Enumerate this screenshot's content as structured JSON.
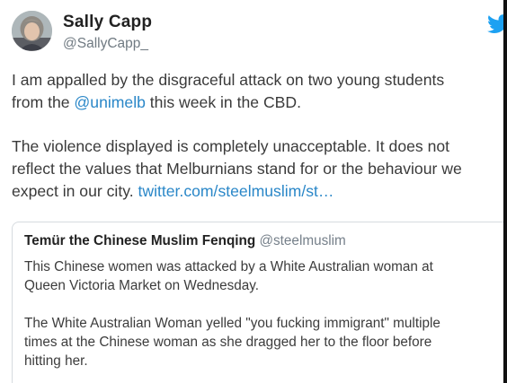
{
  "author": {
    "name": "Sally Capp",
    "handle": "@SallyCapp_"
  },
  "tweet": {
    "line1": "I am appalled by the disgraceful attack on two young students",
    "line2_before": "from the ",
    "line2_mention": "@unimelb",
    "line2_after": " this week in the CBD.",
    "line3": "The violence displayed is completely unacceptable. It does not",
    "line4": "reflect the values that Melburnians stand for or the behaviour we",
    "line5_before": "expect in our city. ",
    "line5_link": "twitter.com/steelmuslim/st…"
  },
  "quoted_tweet": {
    "name": "Temür the Chinese Muslim Fenqing",
    "handle": "@steelmuslim",
    "line1": "This Chinese women was attacked by a White Australian woman at",
    "line2": "Queen Victoria Market on Wednesday.",
    "line3": "The White Australian Woman yelled \"you fucking immigrant\"  multiple",
    "line4": "times at the Chinese woman as she dragged her to the floor before",
    "line5": "hitting her."
  },
  "icons": {
    "avatar": "avatar-photo",
    "logo": "twitter-bird-icon"
  },
  "colors": {
    "link": "#2a87c8",
    "twitter_blue": "#1da1f2",
    "secondary_text": "#707a82"
  }
}
